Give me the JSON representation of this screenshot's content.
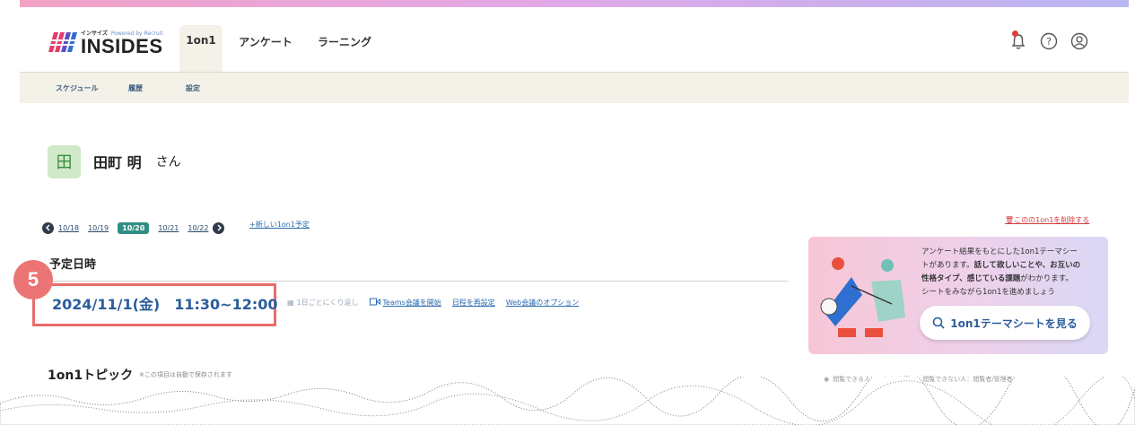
{
  "header": {
    "logo_top": "インサイズ",
    "logo_powered": "Powered by Recruit",
    "logo_main": "INSIDES",
    "tabs": [
      {
        "label": "1on1",
        "active": true
      },
      {
        "label": "アンケート",
        "active": false
      },
      {
        "label": "ラーニング",
        "active": false
      }
    ],
    "icons": [
      "bell-icon",
      "help-icon",
      "user-icon"
    ]
  },
  "subnav": {
    "items": [
      {
        "label": "スケジュール"
      },
      {
        "label": "履歴"
      },
      {
        "label": "設定"
      }
    ]
  },
  "user": {
    "avatar_char": "田",
    "name": "田町 明",
    "honorific": "さん"
  },
  "date_nav": {
    "dates": [
      "10/18",
      "10/19",
      "10/20",
      "10/21",
      "10/22"
    ],
    "active_index": 2,
    "new_link": "+新しい1on1予定",
    "delete_link": "このの1on1を削除する"
  },
  "schedule": {
    "label": "予定日時",
    "datetime": "2024/11/1(金)　11:30~12:00",
    "step_badge": "5",
    "actions": [
      {
        "label": "1日ごとにくり返し",
        "muted": true
      },
      {
        "label": "Teams会議を開始",
        "muted": false
      },
      {
        "label": "日程を再設定",
        "muted": false
      },
      {
        "label": "Web会議のオプション",
        "muted": false
      }
    ]
  },
  "promo": {
    "line1": "アンケート結果をもとにした1on1テーマシー",
    "line2a": "トがあります。",
    "line2b": "話して欲しいことや、お互いの",
    "line3a": "性格タイプ、感じている課題",
    "line3b": "がわかります。",
    "line4": "シートをみながら1on1を進めましょう",
    "button": "1on1テーマシートを見る"
  },
  "topic": {
    "title": "1on1トピック",
    "note": "※この項目は自動で保存されます",
    "legend_visible": "閲覧できる人：あなた/上司",
    "legend_hidden": "閲覧できない人：閲覧者/管理者"
  },
  "colors": {
    "accent": "#2f8f82",
    "link": "#2a6bb0",
    "callout": "#e96b6b",
    "subnav_bg": "#f3f1e8"
  }
}
